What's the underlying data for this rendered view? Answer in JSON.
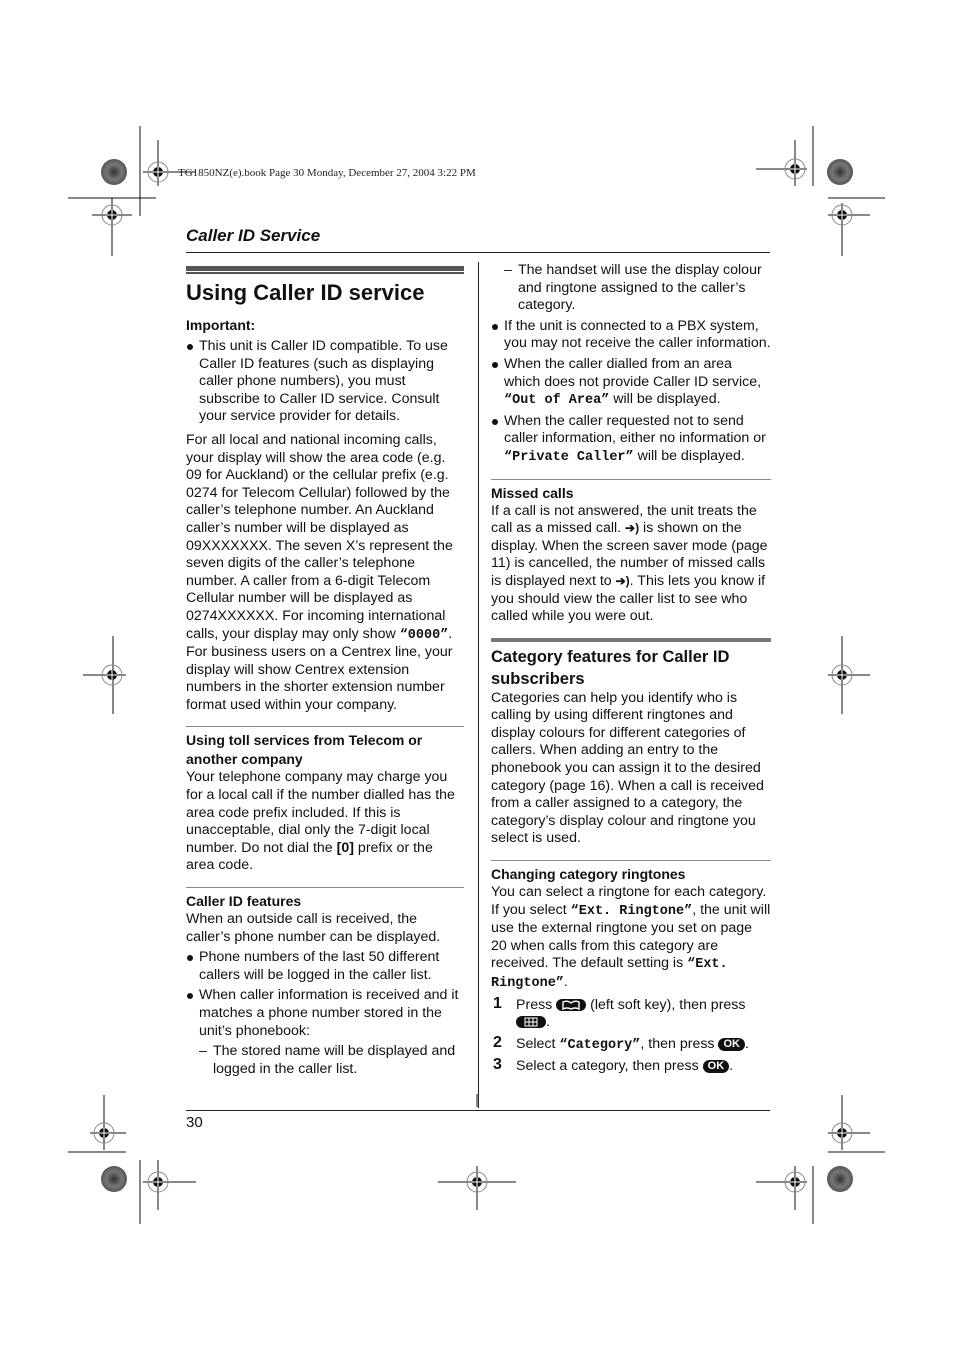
{
  "print_marks": {
    "book_line": "TG1850NZ(e).book  Page 30  Monday, December 27, 2004  3:22 PM"
  },
  "header": {
    "section_title": "Caller ID Service"
  },
  "footer": {
    "page_number": "30"
  },
  "left_column": {
    "title": "Using Caller ID service",
    "important_label": "Important:",
    "important_bullet": "This unit is Caller ID compatible. To use Caller ID features (such as displaying caller phone numbers), you must subscribe to Caller ID service. Consult your service provider for details.",
    "intro_part1": "For all local and national incoming calls, your display will show the area code (e.g. 09 for Auckland) or the cellular prefix (e.g. 0274 for Telecom Cellular) followed by the caller’s telephone number. An Auckland caller’s number will be displayed as 09XXXXXXX. The seven X’s represent the seven digits of the caller’s telephone number. A caller from a 6-digit Telecom Cellular number will be displayed as 0274XXXXXX. For incoming international calls, your display may only show ",
    "intro_code": "“0000”",
    "intro_part2": ". For business users on a Centrex line, your display will show Centrex extension numbers in the shorter extension number format used within your company.",
    "toll": {
      "heading": "Using toll services from Telecom or another company",
      "body_part1": "Your telephone company may charge you for a local call if the number dialled has the area code prefix included. If this is unacceptable, dial only the 7-digit local number. Do not dial the ",
      "key": "[0]",
      "body_part2": " prefix or the area code."
    },
    "features": {
      "heading": "Caller ID features",
      "body": "When an outside call is received, the caller’s phone number can be displayed.",
      "bullets": [
        "Phone numbers of the last 50 different callers will be logged in the caller list.",
        "When caller information is received and it matches a phone number stored in the unit’s phonebook:"
      ],
      "sub_dash": "The stored name will be displayed and logged in the caller list."
    }
  },
  "right_column": {
    "dash_item": "The handset will use the display colour and ringtone assigned to the caller’s category.",
    "bullets": [
      {
        "text": "If the unit is connected to a PBX system, you may not receive the caller information."
      },
      {
        "pre": "When the caller dialled from an area which does not provide Caller ID service, ",
        "code": "“Out of Area”",
        "post": " will be displayed."
      },
      {
        "pre": "When the caller requested not to send caller information, either no information or ",
        "code": "“Private Caller”",
        "post": " will be displayed."
      }
    ],
    "missed": {
      "heading": "Missed calls",
      "part1": "If a call is not answered, the unit treats the call as a missed call. ",
      "icon": "➔)",
      "part2": " is shown on the display. When the screen saver mode (page 11) is cancelled, the number of missed calls is displayed next to ",
      "part3": ". This lets you know if you should view the caller list to see who called while you were out."
    },
    "category": {
      "heading": "Category features for Caller ID subscribers",
      "body": "Categories can help you identify who is calling by using different ringtones and display colours for different categories of callers. When adding an entry to the phonebook you can assign it to the desired category (page 16). When a call is received from a caller assigned to a category, the category’s display colour and ringtone you select is used."
    },
    "ringtones": {
      "heading": "Changing category ringtones",
      "part1": "You can select a ringtone for each category. If you select ",
      "code1": "“Ext. Ringtone”",
      "part2": ", the unit will use the external ringtone you set on page 20 when calls from this category are received. The default setting is ",
      "code2": "“Ext. Ringtone”",
      "part3": "."
    },
    "steps": [
      {
        "num": "1",
        "pre": "Press ",
        "key1": "phonebook-soft-key",
        "mid": " (left soft key), then press ",
        "key2": "menu-key",
        "post": "."
      },
      {
        "num": "2",
        "pre": "Select ",
        "code": "“Category”",
        "mid": ", then press ",
        "ok": "OK",
        "post": "."
      },
      {
        "num": "3",
        "pre": "Select a category, then press ",
        "ok": "OK",
        "post": "."
      }
    ]
  }
}
